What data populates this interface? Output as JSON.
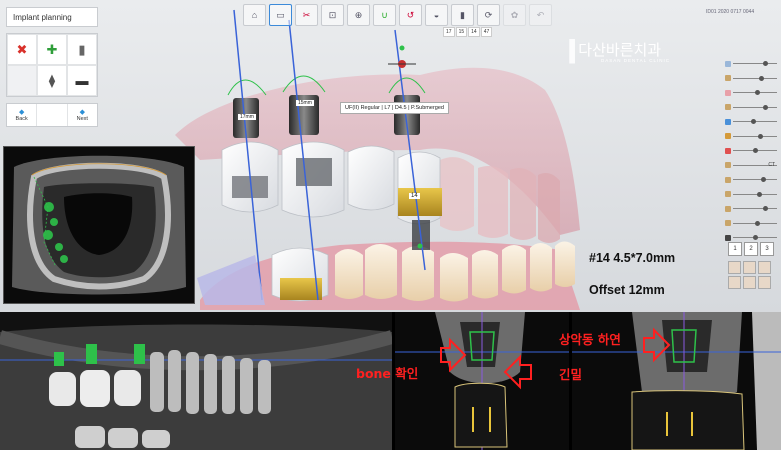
{
  "left_panel": {
    "title": "Implant planning",
    "tools": [
      {
        "icon": "delete-x-icon",
        "glyph": "✖",
        "color": "#d9312b"
      },
      {
        "icon": "add-plus-icon",
        "glyph": "✚",
        "color": "#2f9e3a"
      },
      {
        "icon": "implant-icon",
        "glyph": "▮",
        "color": "#666666"
      },
      {
        "icon": "empty",
        "glyph": "",
        "color": "#666666"
      },
      {
        "icon": "abutment-icon",
        "glyph": "⧫",
        "color": "#555555"
      },
      {
        "icon": "crown-icon",
        "glyph": "▬",
        "color": "#333333"
      }
    ],
    "back_label": "Back",
    "next_label": "Next"
  },
  "toolbar": {
    "items": [
      "home-icon",
      "implant-view-icon",
      "tools-icon",
      "tooth-icon",
      "crown-icon",
      "arch-icon",
      "curve-icon",
      "jaw-icon",
      "cylinder-icon",
      "rotate-icon",
      "faded-icon",
      "undo-icon"
    ],
    "sub_items": [
      "17",
      "15",
      "14",
      "47"
    ]
  },
  "device_id": "ID01 2020 0717 0044",
  "brand": {
    "name": "다산바른치과",
    "sub": "DASAN DENTAL CLINIC"
  },
  "implant_tooltip": "UF(II) Regular | L7 | D4.5 | P.Submerged",
  "implant_labels": [
    "17mm",
    "15mm",
    "14"
  ],
  "tooth_tag": "14",
  "caption": {
    "line1": "#14 4.5*7.0mm",
    "line2": "Offset 12mm"
  },
  "right_controls": {
    "ct_label": "CT",
    "num_buttons": [
      "1",
      "2",
      "3"
    ]
  },
  "annotations": {
    "bone": "bone 확인",
    "sinus_line1": "상악동 하연",
    "sinus_line2": "긴밀"
  },
  "colors": {
    "accent": "#3c8ad9",
    "annotation_red": "#ff2020",
    "implant_green": "#2ec14a"
  }
}
